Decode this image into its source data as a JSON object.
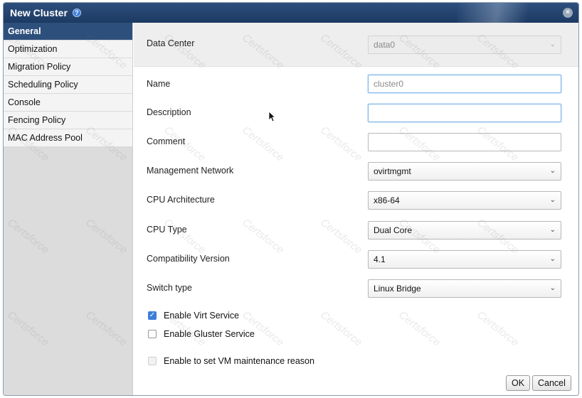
{
  "dialog": {
    "title": "New Cluster",
    "help_glyph": "?",
    "close_glyph": "×"
  },
  "sidebar": {
    "items": [
      {
        "label": "General",
        "active": true
      },
      {
        "label": "Optimization"
      },
      {
        "label": "Migration Policy"
      },
      {
        "label": "Scheduling Policy"
      },
      {
        "label": "Console"
      },
      {
        "label": "Fencing Policy"
      },
      {
        "label": "MAC Address Pool"
      }
    ]
  },
  "form": {
    "data_center": {
      "label": "Data Center",
      "value": "data0"
    },
    "name": {
      "label": "Name",
      "value": "cluster0"
    },
    "description": {
      "label": "Description",
      "value": ""
    },
    "comment": {
      "label": "Comment",
      "value": ""
    },
    "management_network": {
      "label": "Management Network",
      "value": "ovirtmgmt"
    },
    "cpu_architecture": {
      "label": "CPU Architecture",
      "value": "x86-64"
    },
    "cpu_type": {
      "label": "CPU Type",
      "value": "Dual Core"
    },
    "compatibility_version": {
      "label": "Compatibility Version",
      "value": "4.1"
    },
    "switch_type": {
      "label": "Switch type",
      "value": "Linux Bridge"
    },
    "enable_virt": {
      "label": "Enable Virt Service",
      "checked": true
    },
    "enable_gluster": {
      "label": "Enable Gluster Service",
      "checked": false
    },
    "maintenance_reason": {
      "label": "Enable to set VM maintenance reason",
      "checked": false,
      "disabled": true
    }
  },
  "footer": {
    "ok_label": "OK",
    "cancel_label": "Cancel"
  },
  "watermark": {
    "text": "Certsforce"
  },
  "colors": {
    "titlebar": "#2d4f7c",
    "active_tab": "#2d4f7c",
    "checkbox_on": "#3d7ed8"
  },
  "icons": {
    "help": "help-icon",
    "close": "close-icon",
    "chevron": "chevron-down-icon",
    "cursor": "mouse-cursor-icon"
  }
}
